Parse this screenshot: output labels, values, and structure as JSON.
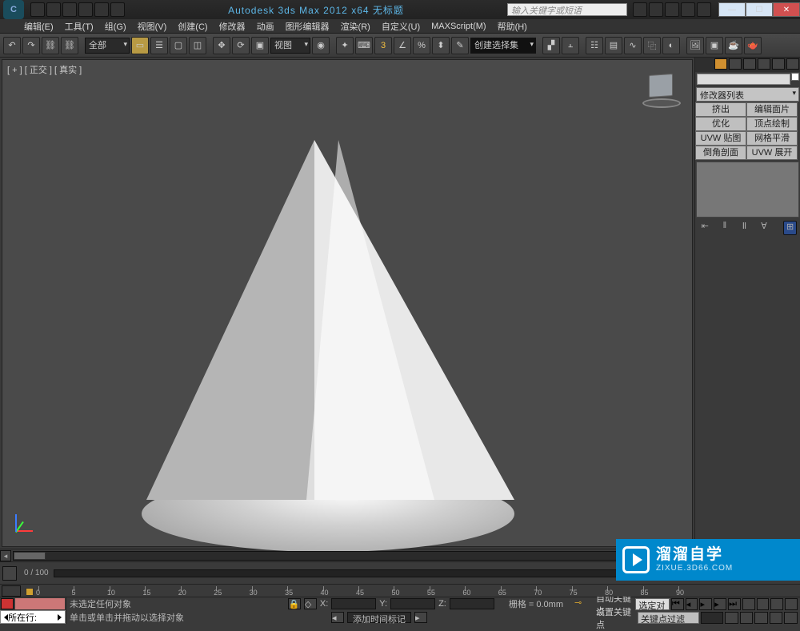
{
  "title": "Autodesk 3ds Max  2012 x64      无标题",
  "search_placeholder": "输入关键字或短语",
  "menu": [
    "编辑(E)",
    "工具(T)",
    "组(G)",
    "视图(V)",
    "创建(C)",
    "修改器",
    "动画",
    "图形编辑器",
    "渲染(R)",
    "自定义(U)",
    "MAXScript(M)",
    "帮助(H)"
  ],
  "toolbar": {
    "scope": "全部",
    "view_btn": "视图",
    "selection_set": "创建选择集"
  },
  "viewport_label": "[ + ] [ 正交 ] [ 真实 ]",
  "sidepanel": {
    "modifier_list": "修改器列表",
    "buttons": [
      "挤出",
      "编辑面片",
      "优化",
      "顶点绘制",
      "UVW 贴图",
      "网格平滑",
      "倒角剖面",
      "UVW 展开"
    ],
    "icons": [
      "⇤",
      "‖",
      "Ⅱ",
      "∀",
      "⊞",
      "∅"
    ]
  },
  "timeline": {
    "frame_label": "0 / 100",
    "ticks": [
      0,
      5,
      10,
      15,
      20,
      25,
      30,
      35,
      40,
      45,
      50,
      55,
      60,
      65,
      70,
      75,
      80,
      85,
      90
    ]
  },
  "status": {
    "row_label": "所在行:",
    "no_selection": "未选定任何对象",
    "hint": "单击或单击并拖动以选择对象",
    "add_time_tag": "添加时间标记",
    "coord_x": "X:",
    "coord_y": "Y:",
    "coord_z": "Z:",
    "grid": "栅格 = 0.0mm",
    "autokey": "自动关键点",
    "selected": "选定对象",
    "setkey": "设置关键点",
    "keyfilter": "关键点过滤器..."
  },
  "watermark": {
    "cn": "溜溜自学",
    "en": "ZIXUE.3D66.COM"
  }
}
